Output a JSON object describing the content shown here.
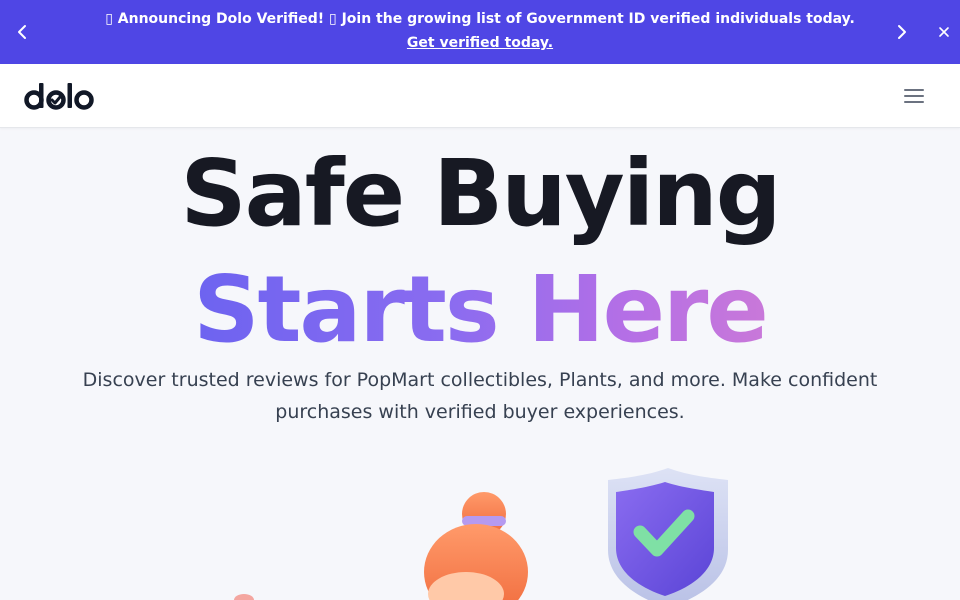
{
  "announcement": {
    "message": "▯ Announcing Dolo Verified! ▯ Join the growing list of Government ID verified individuals today.",
    "link_text": "Get verified today.",
    "prev_icon": "chevron-left-icon",
    "next_icon": "chevron-right-icon",
    "close_icon": "close-icon",
    "background": "#4f46e5"
  },
  "header": {
    "logo_text": "dolo",
    "menu_icon": "hamburger-menu-icon"
  },
  "hero": {
    "title_line1": "Safe Buying",
    "title_line2": "Starts Here",
    "subtitle": "Discover trusted reviews for PopMart collectibles, Plants, and more. Make confident purchases with verified buyer experiences.",
    "gradient_colors": [
      "#6d63f0",
      "#c978d9"
    ]
  },
  "illustration": {
    "items": [
      "character-illustration",
      "shield-check-illustration"
    ]
  }
}
